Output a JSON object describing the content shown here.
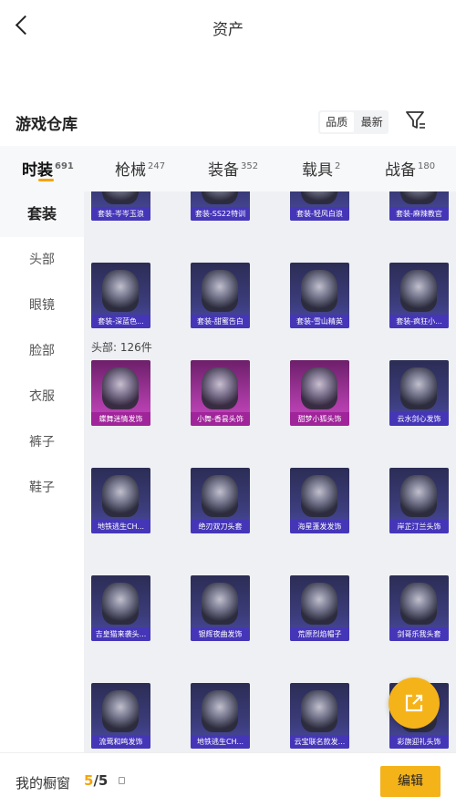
{
  "header": {
    "title": "资产"
  },
  "warehouse": {
    "title": "游戏仓库",
    "sort": [
      "品质",
      "最新"
    ]
  },
  "tabs": [
    {
      "label": "时装",
      "count": "691"
    },
    {
      "label": "枪械",
      "count": "247"
    },
    {
      "label": "装备",
      "count": "352"
    },
    {
      "label": "载具",
      "count": "2"
    },
    {
      "label": "战备",
      "count": "180"
    }
  ],
  "sidebar": [
    "套装",
    "头部",
    "眼镜",
    "脸部",
    "衣服",
    "裤子",
    "鞋子"
  ],
  "section_label": "头部: 126件",
  "suits_partial": [
    "套装-岑岑玉浪",
    "套装-SS22特训",
    "套装-轻风白浪",
    "套装-麻辣教官"
  ],
  "suits": [
    "套装-深蓝色...",
    "套装-甜蜜告白",
    "套装-雪山精英",
    "套装-疯狂小..."
  ],
  "head_items": [
    "蝶舞迷情发饰",
    "小舞-香昙头饰",
    "甜梦小狐头饰",
    "云水剑心发饰",
    "地铁逃生CH...",
    "绝刃双刀头套",
    "海星蓬发发饰",
    "岸芷汀兰头饰",
    "吉皇猫来袭头...",
    "银辉夜曲发饰",
    "荒原烈焰帽子",
    "剑哥乐我头套",
    "流莺和鸣发饰",
    "地铁逃生CH...",
    "云宝联名款发...",
    "彩旗迎礼头饰"
  ],
  "footer": {
    "showcase_label": "我的橱窗",
    "current": "5",
    "separator": "/",
    "total": "5",
    "edit_label": "编辑"
  }
}
